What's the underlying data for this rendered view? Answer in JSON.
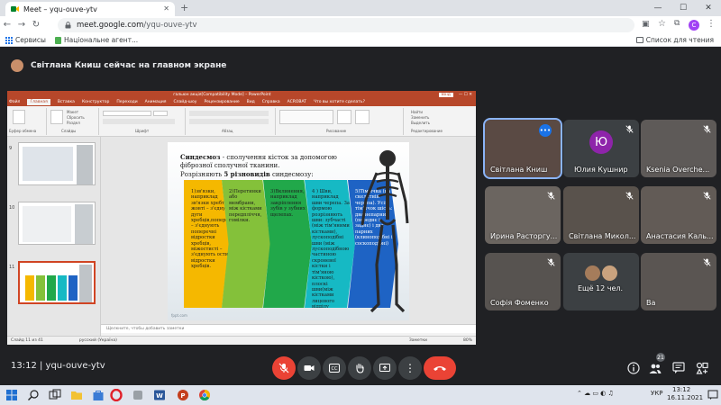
{
  "browser": {
    "tab_title": "Meet – yqu-ouve-ytv",
    "url_host": "meet.google.com",
    "url_path": "/yqu-ouve-ytv",
    "profile_letter": "C",
    "bookmarks": [
      {
        "label": "Сервисы"
      },
      {
        "label": "Національне агент..."
      }
    ],
    "reading_list": "Список для чтения"
  },
  "banner": {
    "text": "Світлана Книш сейчас на главном экране"
  },
  "ppt": {
    "title_center": "гальюн акція[Compatibility Mode] – PowerPoint",
    "title_search": "Вхід",
    "tabs": [
      "Файл",
      "Главная",
      "Вставка",
      "Конструктор",
      "Переходи",
      "Анимация",
      "Слайд-шоу",
      "Рецензирование",
      "Вид",
      "Справка",
      "ACROBAT",
      "Что вы хотите сделать?"
    ],
    "ribbon_groups": [
      "Буфер обмена",
      "Слайды",
      "Шрифт",
      "Абзац",
      "Рисование",
      "Редактирование"
    ],
    "ribbon_items": [
      "Макет",
      "Сбросить",
      "Раздел",
      "Найти",
      "Заменить",
      "Выделить"
    ],
    "notes_placeholder": "Щелкните, чтобы добавить заметки",
    "status_slide": "Слайд 11 из 41",
    "status_lang": "русский (Україна)",
    "status_notes": "Заметки",
    "status_zoom": "80%",
    "thumb_numbers": [
      "9",
      "10",
      "11"
    ],
    "slide": {
      "title_bold": "Синдесмоз",
      "title_rest": " - сполучення кісток за допомогою фіброзної сполучної тканини.",
      "subtitle_pre": "Розрізняють ",
      "subtitle_bold": "5 різновидів",
      "subtitle_post": " синдесмозу:",
      "chevrons": [
        {
          "text": "1)зв'язки, наприклад зв'язки хребта – жовті – з'єднують дуги хребців,поперечні – з'єднують поперечні відростки хребців, міжостисті – з'єднують остисті відростки хребців.",
          "color": "#f5b800"
        },
        {
          "text": "2)Перетинки або мембрани, між кістками передпліччя, гомілки.",
          "color": "#84c13a"
        },
        {
          "text": "3)Вклинення, наприклад закріплення зубів у зубних щелепах.",
          "color": "#21a84a"
        },
        {
          "text": "4 ) Шви, наприклад шви черепа. За формою розрізняють шви: зубчасті (між тім'яними кістками), лускоподібні шви (між лускоподібною частиною скроневої кістки і тім'яною кісткою), плоскі шви(між кістками лицевого відділу черепа)",
          "color": "#16b9c4"
        },
        {
          "text": "5)Тім'ячка (на скелетній черепа). Усіх тім'ячок шість: два непарних (переднє і заднє) і два парних (клиноподібні і соскоподібні)",
          "color": "#1e63c4"
        }
      ],
      "footer": "fppt.com"
    }
  },
  "participants": [
    {
      "name": "Світлана Книш",
      "kind": "video",
      "speaking": true,
      "more": "•••"
    },
    {
      "name": "Юлия Кушнир",
      "kind": "letter",
      "letter": "Ю"
    },
    {
      "name": "Ksenia Overche...",
      "kind": "video"
    },
    {
      "name": "Ирина Расторгу...",
      "kind": "video"
    },
    {
      "name": "Світлана Микол...",
      "kind": "video"
    },
    {
      "name": "Анастасия Каль...",
      "kind": "video"
    },
    {
      "name": "Софія Фоменко",
      "kind": "video"
    },
    {
      "name": "Ещё 12 чел.",
      "kind": "more"
    },
    {
      "name": "Ва",
      "kind": "video"
    }
  ],
  "meet_bar": {
    "time_code": "13:12  |  yqu-ouve-ytv",
    "people_count": "21"
  },
  "taskbar": {
    "lang": "УКР",
    "time": "13:12",
    "date": "16.11.2021"
  },
  "colors": {
    "meet_bg": "#202124",
    "ppt_accent": "#b7472a",
    "hangup_red": "#ea4335",
    "speaking_outline": "#8ab4f8"
  }
}
